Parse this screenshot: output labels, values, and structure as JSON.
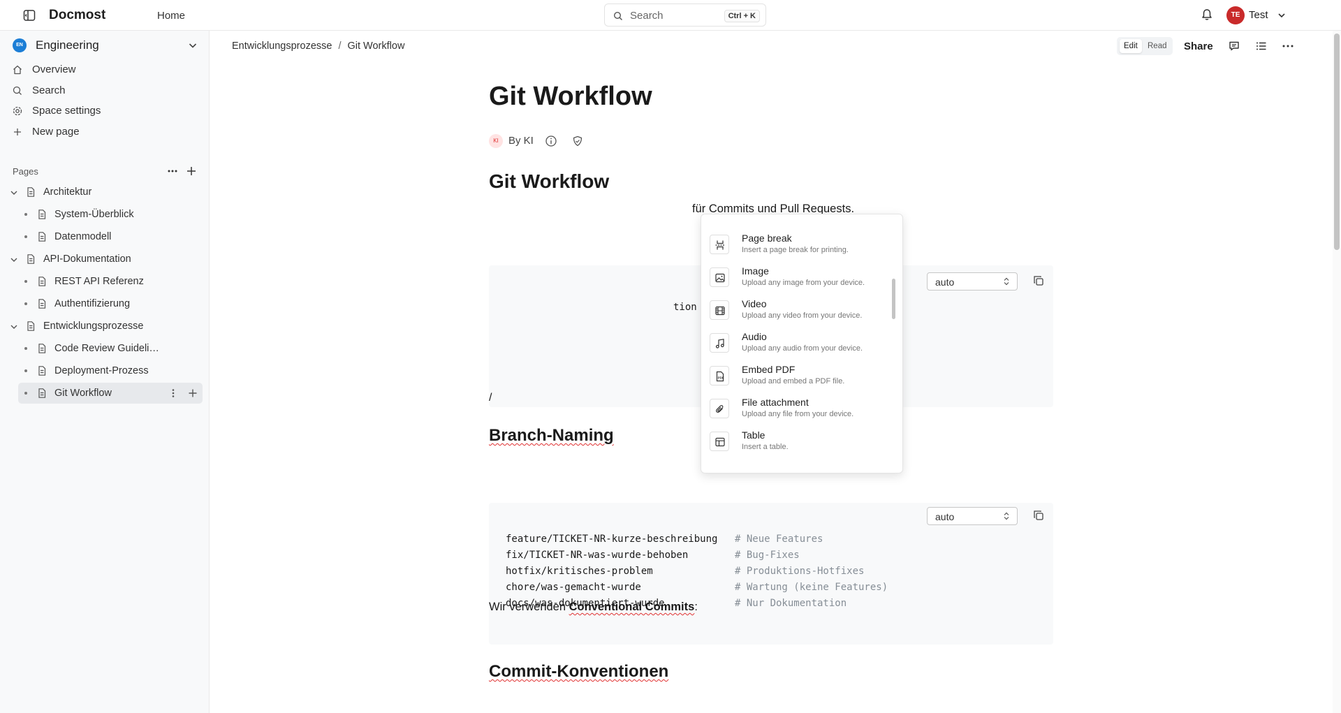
{
  "app": {
    "brand": "Docmost",
    "home_label": "Home"
  },
  "search": {
    "label": "Search",
    "shortcut": "Ctrl + K"
  },
  "user": {
    "initials": "TE",
    "name": "Test"
  },
  "sidebar": {
    "space": {
      "initials": "EN",
      "name": "Engineering"
    },
    "nav": [
      {
        "label": "Overview",
        "icon": "home-icon"
      },
      {
        "label": "Search",
        "icon": "search-icon"
      },
      {
        "label": "Space settings",
        "icon": "gear-icon"
      },
      {
        "label": "New page",
        "icon": "plus-icon"
      }
    ],
    "pages_header": "Pages",
    "tree": [
      {
        "label": "Architektur",
        "level": 0,
        "expanded": true
      },
      {
        "label": "System-Überblick",
        "level": 1
      },
      {
        "label": "Datenmodell",
        "level": 1
      },
      {
        "label": "API-Dokumentation",
        "level": 0,
        "expanded": true
      },
      {
        "label": "REST API Referenz",
        "level": 1
      },
      {
        "label": "Authentifizierung",
        "level": 1
      },
      {
        "label": "Entwicklungsprozesse",
        "level": 0,
        "expanded": true
      },
      {
        "label": "Code Review Guideli…",
        "level": 1
      },
      {
        "label": "Deployment-Prozess",
        "level": 1
      },
      {
        "label": "Git Workflow",
        "level": 1,
        "active": true
      }
    ]
  },
  "header": {
    "breadcrumb": [
      "Entwicklungsprozesse",
      "Git Workflow"
    ],
    "mode": {
      "edit": "Edit",
      "read": "Read",
      "active": "Edit"
    },
    "share_label": "Share"
  },
  "page": {
    "title": "Git Workflow",
    "author_initials": "KI",
    "byline": "By KI",
    "heading_partial": "Git Workflow",
    "intro_tail_1": "für ",
    "intro_word_commits": "Commits",
    "intro_tail_2": " und Pull ",
    "intro_word_requests": "Requests",
    "intro_tail_3": ".",
    "code1": {
      "language": "auto",
      "visible_fragment": "tion"
    },
    "slash_text": "/",
    "section_branch": "Branch-Naming",
    "code2": {
      "language": "auto",
      "lines": [
        {
          "code": "feature/TICKET-NR-kurze-beschreibung",
          "comment": "# Neue Features"
        },
        {
          "code": "fix/TICKET-NR-was-wurde-behoben",
          "comment": "# Bug-Fixes"
        },
        {
          "code": "hotfix/kritisches-problem",
          "comment": "# Produktions-Hotfixes"
        },
        {
          "code": "chore/was-gemacht-wurde",
          "comment": "# Wartung (keine Features)"
        },
        {
          "code": "docs/was-dokumentiert-wurde",
          "comment": "# Nur Dokumentation"
        }
      ]
    },
    "section_commits": "Commit-Konventionen",
    "commits_intro_pre": "Wir verwenden ",
    "commits_intro_bold": "Conventional Commits",
    "commits_intro_post": ":"
  },
  "slash_menu": {
    "items": [
      {
        "title": "Page break",
        "desc": "Insert a page break for printing.",
        "icon": "page-break-icon"
      },
      {
        "title": "Image",
        "desc": "Upload any image from your device.",
        "icon": "image-icon"
      },
      {
        "title": "Video",
        "desc": "Upload any video from your device.",
        "icon": "video-icon"
      },
      {
        "title": "Audio",
        "desc": "Upload any audio from your device.",
        "icon": "audio-icon"
      },
      {
        "title": "Embed PDF",
        "desc": "Upload and embed a PDF file.",
        "icon": "pdf-icon"
      },
      {
        "title": "File attachment",
        "desc": "Upload any file from your device.",
        "icon": "paperclip-icon"
      },
      {
        "title": "Table",
        "desc": "Insert a table.",
        "icon": "table-icon"
      }
    ]
  },
  "colors": {
    "accent": "#1c7ed6",
    "avatar_user": "#c92a2a",
    "active_row": "#e7e9ec",
    "code_bg": "#f8f9fa"
  }
}
